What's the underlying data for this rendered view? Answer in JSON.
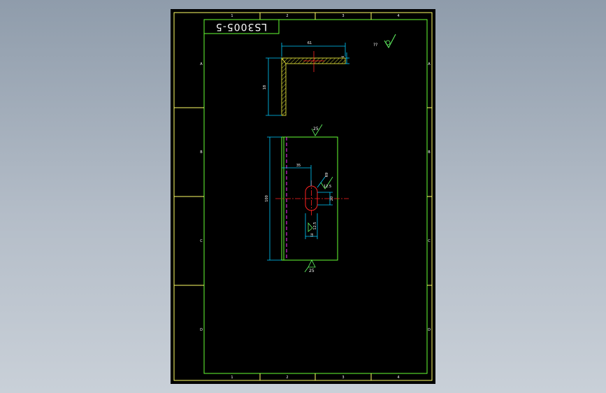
{
  "colors": {
    "sheet": "#000000",
    "border": "#ffff66",
    "frame": "#66ff33",
    "dimension": "#00ccff",
    "hatch": "#cccc33",
    "centerline": "#ff2222",
    "hidden_line": "#ff33ff",
    "symbol": "#66ff66",
    "text": "#ffffff"
  },
  "drawing": {
    "title_block_text": "LS3005-5",
    "zone_columns": [
      "1",
      "2",
      "3",
      "4"
    ],
    "zone_rows": [
      "A",
      "B",
      "C",
      "D"
    ]
  },
  "angle_view": {
    "dim_width": "61",
    "dim_height": "18",
    "dim_thickness": "6"
  },
  "plate_view": {
    "dim_height": "100",
    "dim_offset": "35",
    "dim_slot_radius": "R9",
    "dim_slot_width": "20",
    "dim_slot_depth": "18",
    "roughness_slot_top": "12.5",
    "roughness_slot_bottom": "12.5",
    "roughness_top_edge": "25",
    "roughness_bottom_edge": "25"
  },
  "general_roughness": {
    "label": "??"
  }
}
